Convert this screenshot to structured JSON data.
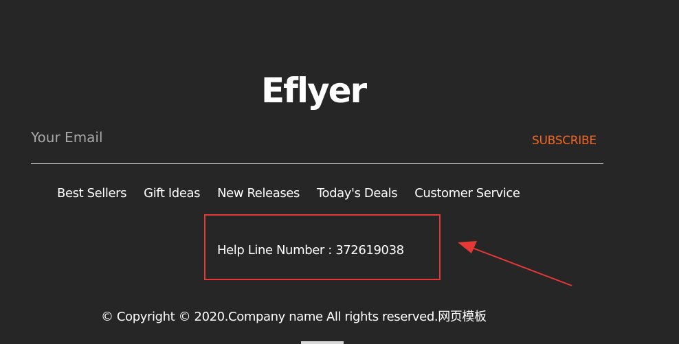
{
  "brand": {
    "logo_text": "Eflyer"
  },
  "newsletter": {
    "email_placeholder": "Your Email",
    "subscribe_label": "SUBSCRIBE"
  },
  "nav": {
    "items": [
      {
        "label": "Best Sellers"
      },
      {
        "label": "Gift Ideas"
      },
      {
        "label": "New Releases"
      },
      {
        "label": "Today's Deals"
      },
      {
        "label": "Customer Service"
      }
    ]
  },
  "help": {
    "text": "Help Line Number : 372619038"
  },
  "footer": {
    "copyright": "© Copyright © 2020.Company name All rights reserved.网页模板"
  },
  "colors": {
    "background": "#262626",
    "accent": "#f26522",
    "annotation": "#e53935",
    "text": "#ffffff"
  }
}
